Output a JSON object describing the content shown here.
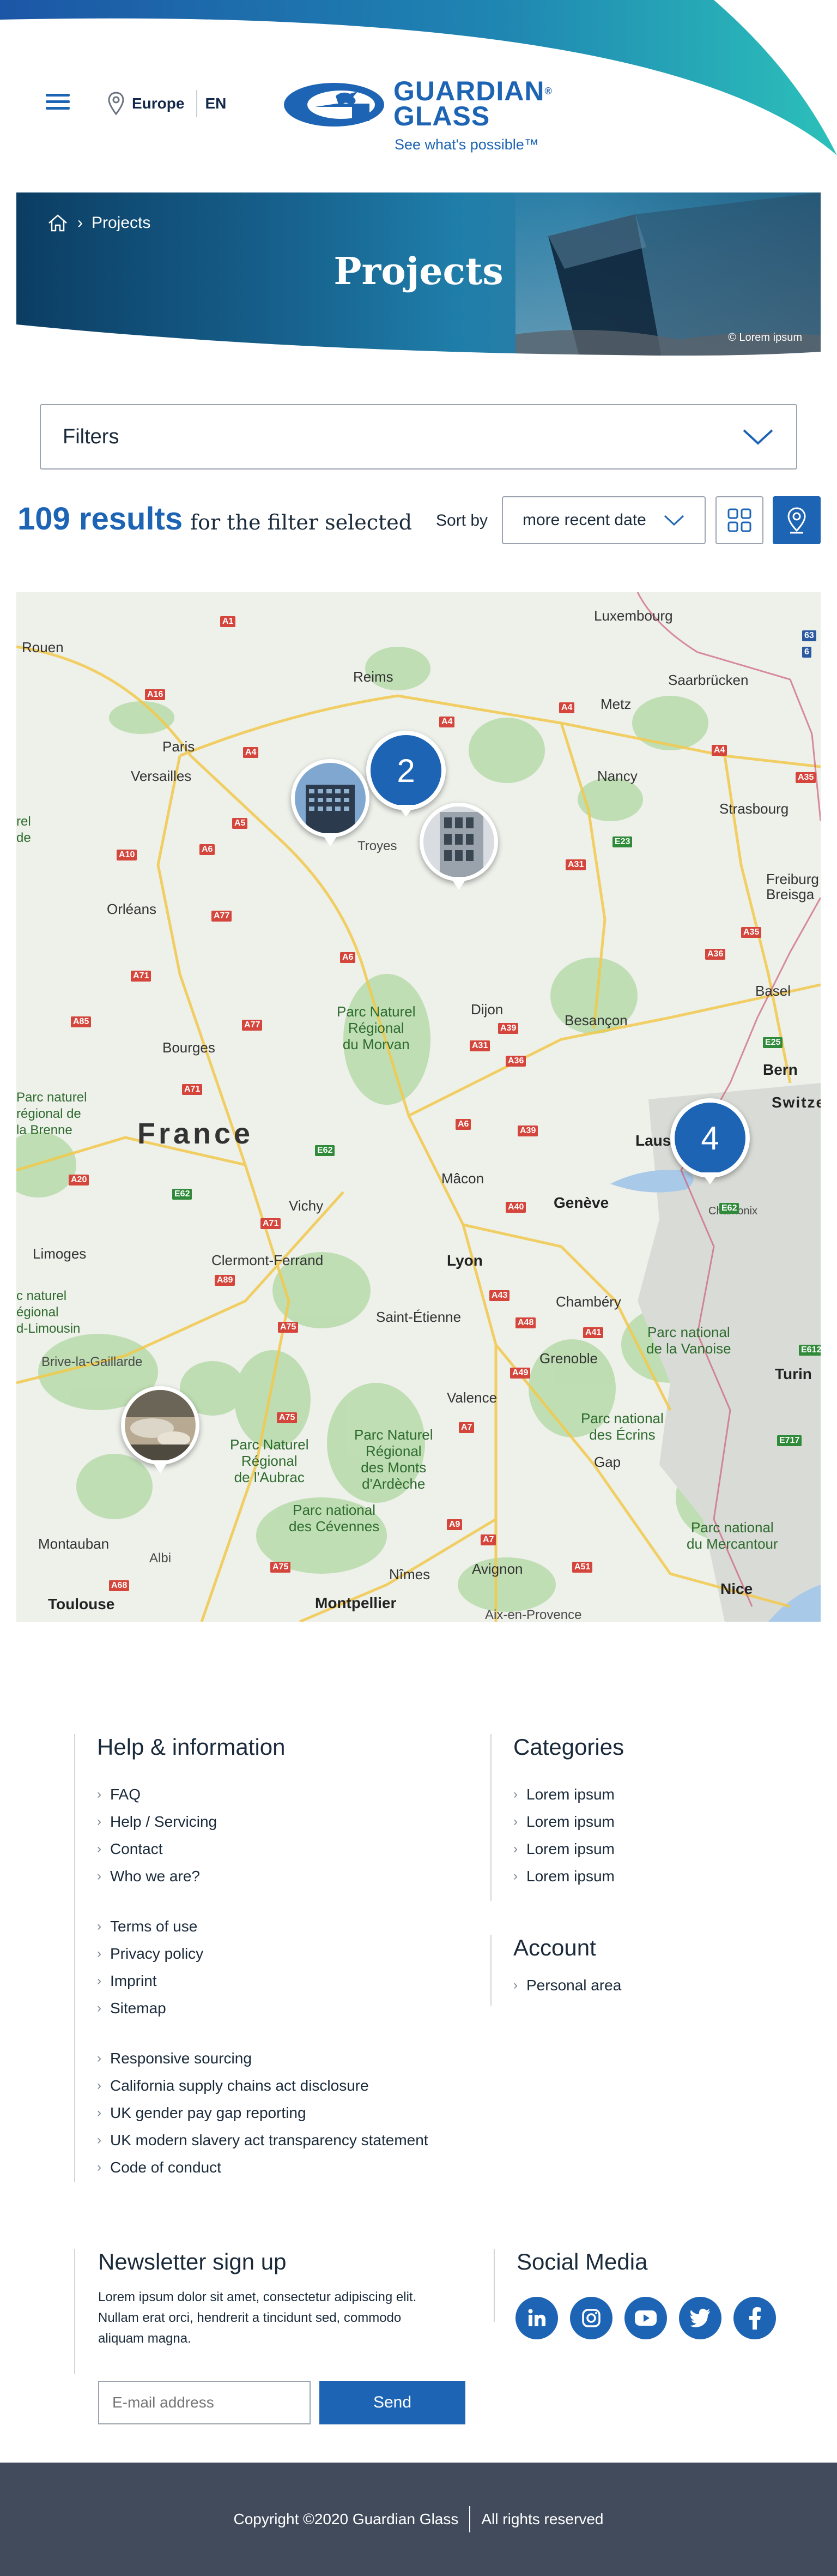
{
  "header": {
    "region": "Europe",
    "language": "EN",
    "logo_line1": "GUARDIAN",
    "logo_line2": "GLASS",
    "logo_registered": "®",
    "tagline": "See what's possible™"
  },
  "hero": {
    "breadcrumb_current": "Projects",
    "title": "Projects",
    "credit": "© Lorem ipsum"
  },
  "filters": {
    "label": "Filters"
  },
  "results": {
    "count": "109 results",
    "suffix": "for the filter selected",
    "sort_label": "Sort by",
    "sort_value": "more recent date"
  },
  "map": {
    "country_label": "France",
    "clusters": [
      "2",
      "4"
    ],
    "cities": {
      "rouen": "Rouen",
      "paris": "Paris",
      "versailles": "Versailles",
      "reims": "Reims",
      "troyes": "Troyes",
      "metz": "Metz",
      "nancy": "Nancy",
      "luxembourg": "Luxembourg",
      "saarbrucken": "Saarbrücken",
      "strasbourg": "Strasbourg",
      "orleans": "Orléans",
      "bourges": "Bourges",
      "dijon": "Dijon",
      "besancon": "Besançon",
      "basel": "Basel",
      "bern": "Bern",
      "lausanne": "Lausa",
      "geneva": "Genève",
      "chamonix": "Chamonix",
      "vichy": "Vichy",
      "macon": "Mâcon",
      "limoges": "Limoges",
      "clermont": "Clermont-Ferrand",
      "lyon": "Lyon",
      "saint_etienne": "Saint-Étienne",
      "chambery": "Chambéry",
      "grenoble": "Grenoble",
      "turin": "Turin",
      "valence": "Valence",
      "gap": "Gap",
      "brive": "Brive-la-Gaillarde",
      "montauban": "Montauban",
      "albi": "Albi",
      "toulouse": "Toulouse",
      "nimes": "Nîmes",
      "avignon": "Avignon",
      "montpellier": "Montpellier",
      "nice": "Nice",
      "aix": "Aix-en-Provence",
      "freiburg": "Freiburg\nBreisga",
      "switz": "Switze",
      "rel": "rel\nde",
      "brenne": "Parc naturel\nrégional de\nla Brenne",
      "limousin": "c naturel\négional\nd-Limousin"
    },
    "parks": {
      "morvan": "Parc Naturel\nRégional\ndu Morvan",
      "aubrac": "Parc Naturel\nRégional\nde l'Aubrac",
      "ardeche": "Parc Naturel\nRégional\ndes Monts\nd'Ardèche",
      "cevennes": "Parc national\ndes Cévennes",
      "vanoise": "Parc national\nde la Vanoise",
      "ecrins": "Parc national\ndes Écrins",
      "mercantour": "Parc national\ndu Mercantour"
    },
    "roads": [
      "A1",
      "A16",
      "A4",
      "A4",
      "A4",
      "A4",
      "A35",
      "A5",
      "A6",
      "A10",
      "A77",
      "A31",
      "A71",
      "A6",
      "A85",
      "A77",
      "A39",
      "A31",
      "A36",
      "A36",
      "A35",
      "A71",
      "A6",
      "A39",
      "A20",
      "E62",
      "E62",
      "A40",
      "A71",
      "A89",
      "A43",
      "A75",
      "A48",
      "A41",
      "A49",
      "A7",
      "A75",
      "A7",
      "A9",
      "A51",
      "A68",
      "A75",
      "E23",
      "E25",
      "E612",
      "E717",
      "E62",
      "63",
      "6"
    ]
  },
  "footer": {
    "help_title": "Help & information",
    "help_links_1": [
      "FAQ",
      "Help / Servicing",
      "Contact",
      "Who we are?"
    ],
    "help_links_2": [
      "Terms of use",
      "Privacy policy",
      "Imprint",
      "Sitemap"
    ],
    "help_links_3": [
      "Responsive sourcing",
      "California supply chains act disclosure",
      "UK gender pay gap reporting",
      "UK modern slavery act transparency statement",
      "Code of conduct"
    ],
    "categories_title": "Categories",
    "categories_links": [
      "Lorem ipsum",
      "Lorem ipsum",
      "Lorem ipsum",
      "Lorem ipsum"
    ],
    "account_title": "Account",
    "account_links": [
      "Personal area"
    ],
    "newsletter_title": "Newsletter sign up",
    "newsletter_text": "Lorem ipsum dolor sit amet, consectetur adipiscing elit. Nullam erat orci, hendrerit a tincidunt sed, commodo aliquam magna.",
    "email_placeholder": "E-mail address",
    "send_label": "Send",
    "social_title": "Social Media",
    "social_icons": [
      "linkedin-icon",
      "instagram-icon",
      "youtube-icon",
      "twitter-icon",
      "facebook-icon"
    ],
    "copyright": "Copyright ©2020 Guardian Glass",
    "rights": "All rights reserved"
  },
  "colors": {
    "brand_blue": "#1d64b4",
    "teal": "#2ab3b8",
    "footer_bar": "#424b5c"
  }
}
